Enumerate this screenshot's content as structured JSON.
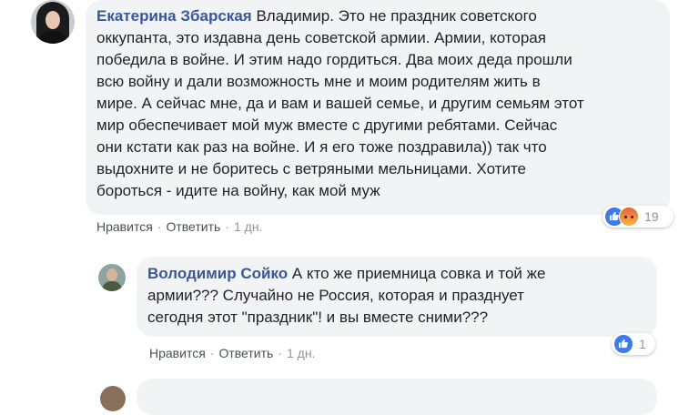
{
  "comments": [
    {
      "author": "Екатерина Збарская",
      "text_lines": [
        "Владимир. Это не праздник советского",
        "оккупанта, это издавна день советской армии. Армии, которая",
        "победила в войне. И этим надо гордиться. Два моих деда прошли",
        "всю войну и дали возможность мне и моим родителям жить в",
        "мире. А сейчас мне, да и вам и вашей семье, и другим семьям этот",
        "мир обеспечивает мой муж вместе с другими ребятами. Сейчас",
        "они кстати как раз на войне. И я его тоже поздравила)) так что",
        "выдохните и не боритесь с ветряными мельницами. Хотите",
        "бороться - идите на войну, как мой муж"
      ],
      "like_label": "Нравится",
      "reply_label": "Ответить",
      "time": "1 дн.",
      "reaction_count": "19",
      "reaction_icons": [
        "like-icon",
        "angry-icon"
      ]
    },
    {
      "author": "Володимир Сойко",
      "text_lines": [
        "А кто же приемница совка и той же",
        "армии??? Случайно не Россия, которая и празднует",
        "сегодня этот \"праздник\"! и вы вместе сними???"
      ],
      "like_label": "Нравится",
      "reply_label": "Ответить",
      "time": "1 дн.",
      "reaction_count": "1",
      "reaction_icons": [
        "like-icon"
      ]
    }
  ],
  "separator": "·",
  "colors": {
    "author": "#385898",
    "bubble": "#f2f3f5",
    "meta": "#90949c",
    "like": "#3b7bea"
  }
}
